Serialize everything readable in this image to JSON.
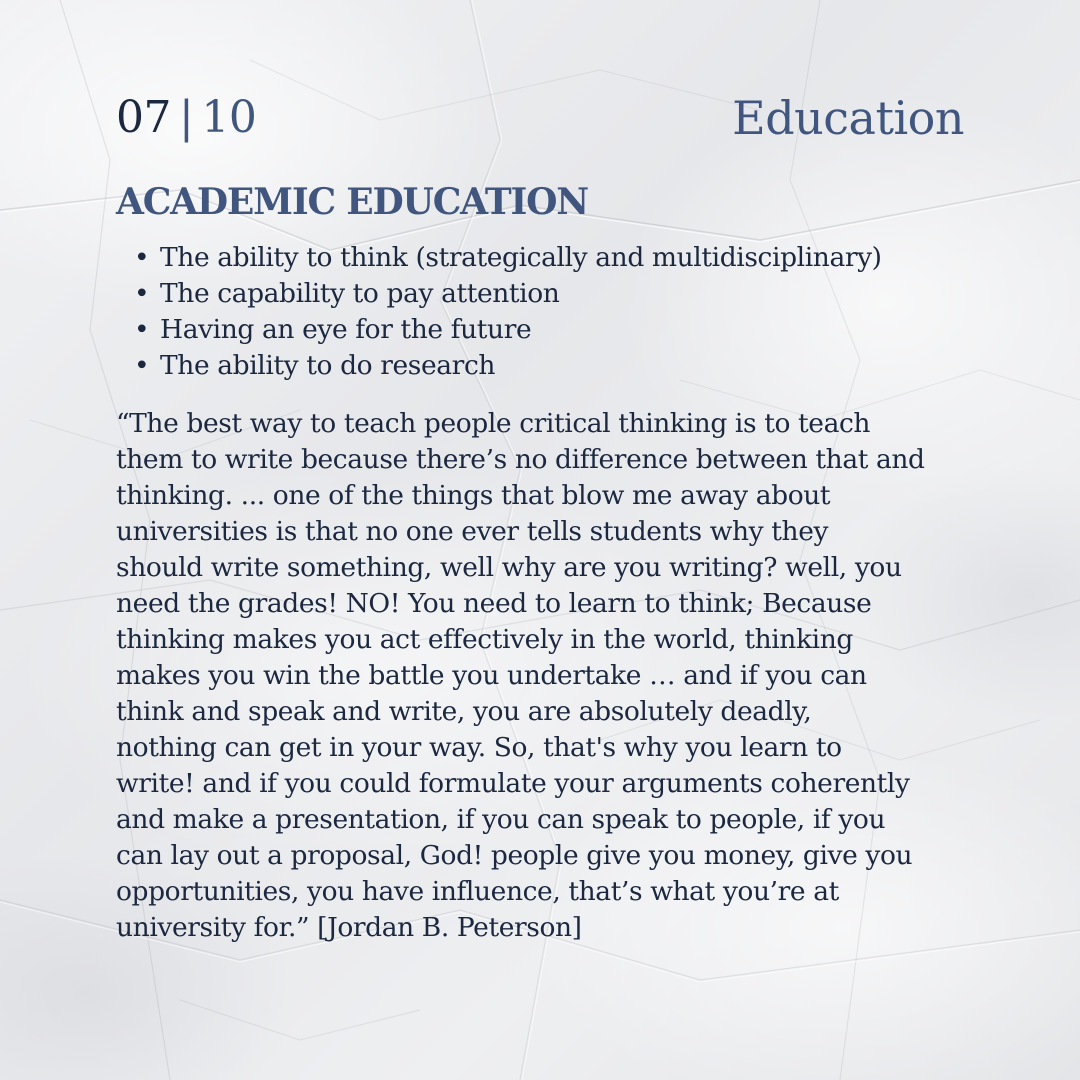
{
  "header": {
    "page_current": "07",
    "page_separator": "|",
    "page_total": "10",
    "section": "Education"
  },
  "heading": "ACADEMIC EDUCATION",
  "bullets": [
    "The ability to think (strategically and multidisciplinary)",
    "The capability to pay attention",
    "Having an eye for the future",
    "The ability to do research"
  ],
  "quote_lines": [
    "“The best way to teach people critical thinking is to teach",
    "them to write because there’s no difference between that and",
    "thinking. ... one of the things that blow me away about",
    "universities is that no one ever tells students why they",
    "should write something, well why are you writing? well, you",
    "need the grades! NO! You need to learn to think; Because",
    "thinking makes you act effectively in the world, thinking",
    "makes you win the battle you undertake … and if you can",
    "think and speak and write, you are absolutely deadly,",
    "nothing can get in your way. So, that's why you learn to",
    "write! and if you could formulate your arguments coherently",
    "and make a presentation, if you can speak to people, if you",
    "can lay out a proposal, God! people give you money, give you",
    "opportunities, you have influence, that’s what you’re at",
    "university for.” [Jordan B. Peterson]"
  ],
  "colors": {
    "dark_text": "#1c2840",
    "accent_blue": "#41567f",
    "paper": "#ecedef"
  }
}
